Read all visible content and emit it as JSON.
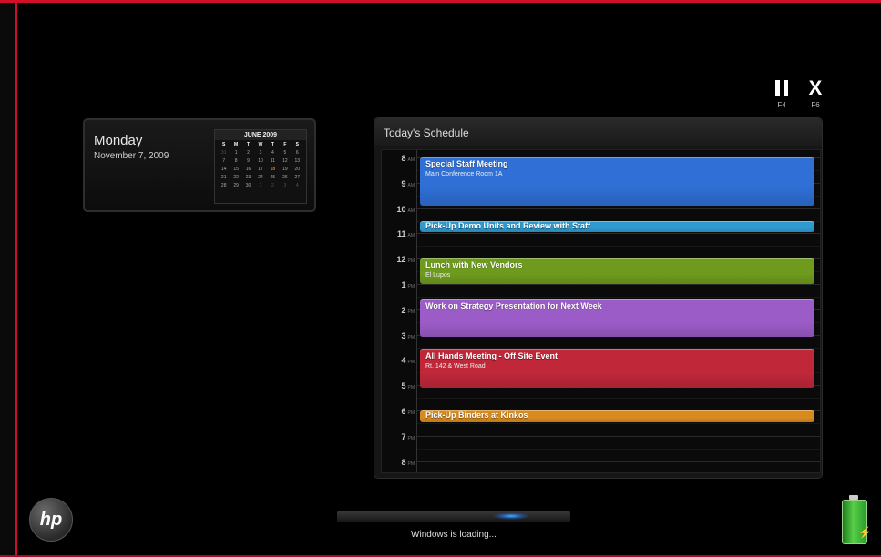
{
  "controls": {
    "pause": {
      "icon": "pause-icon",
      "key": "F4"
    },
    "close": {
      "symbol": "X",
      "key": "F6"
    }
  },
  "date_widget": {
    "weekday": "Monday",
    "full_date": "November 7, 2009",
    "calendar": {
      "title": "JUNE 2009",
      "dow": [
        "S",
        "M",
        "T",
        "W",
        "T",
        "F",
        "S"
      ],
      "weeks": [
        [
          "31",
          "1",
          "2",
          "3",
          "4",
          "5",
          "6"
        ],
        [
          "7",
          "8",
          "9",
          "10",
          "11",
          "12",
          "13"
        ],
        [
          "14",
          "15",
          "16",
          "17",
          "18",
          "19",
          "20"
        ],
        [
          "21",
          "22",
          "23",
          "24",
          "25",
          "26",
          "27"
        ],
        [
          "28",
          "29",
          "30",
          "1",
          "2",
          "3",
          "4"
        ]
      ]
    }
  },
  "schedule": {
    "title": "Today's Schedule",
    "hours": [
      {
        "h": "8",
        "ap": "AM"
      },
      {
        "h": "9",
        "ap": "AM"
      },
      {
        "h": "10",
        "ap": "AM"
      },
      {
        "h": "11",
        "ap": "AM"
      },
      {
        "h": "12",
        "ap": "PM"
      },
      {
        "h": "1",
        "ap": "PM"
      },
      {
        "h": "2",
        "ap": "PM"
      },
      {
        "h": "3",
        "ap": "PM"
      },
      {
        "h": "4",
        "ap": "PM"
      },
      {
        "h": "5",
        "ap": "PM"
      },
      {
        "h": "6",
        "ap": "PM"
      },
      {
        "h": "7",
        "ap": "PM"
      },
      {
        "h": "8",
        "ap": "PM"
      }
    ],
    "events": [
      {
        "title": "Special Staff Meeting",
        "location": "Main Conference Room 1A",
        "start": 8.0,
        "end": 9.9,
        "color": "#2f6fd6"
      },
      {
        "title": "Pick-Up Demo Units and Review with Staff",
        "location": "",
        "start": 10.5,
        "end": 10.95,
        "color": "#2f9ad0"
      },
      {
        "title": "Lunch with New Vendors",
        "location": "El Lupos",
        "start": 12.0,
        "end": 13.0,
        "color": "#6e9a1e"
      },
      {
        "title": "Work on Strategy Presentation for Next Week",
        "location": "",
        "start": 13.6,
        "end": 15.1,
        "color": "#9b5cc8"
      },
      {
        "title": "All Hands Meeting - Off Site Event",
        "location": "Rt. 142 & West Road",
        "start": 15.6,
        "end": 17.1,
        "color": "#c0283a"
      },
      {
        "title": "Pick-Up Binders at Kinkos",
        "location": "",
        "start": 18.0,
        "end": 18.45,
        "color": "#d98a1e"
      }
    ]
  },
  "brand": {
    "logo_text": "hp"
  },
  "status": {
    "loading_text": "Windows is loading..."
  },
  "battery": {
    "icon": "battery-charging-icon",
    "level": 1.0
  }
}
